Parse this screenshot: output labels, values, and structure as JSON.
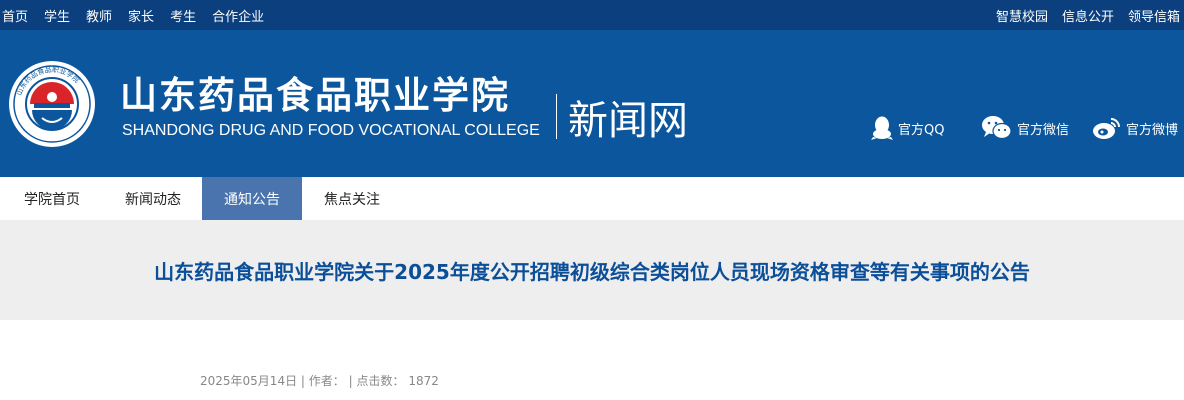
{
  "topbar": {
    "left_links": [
      "首页",
      "学生",
      "教师",
      "家长",
      "考生",
      "合作企业"
    ],
    "right_links": [
      "智慧校园",
      "信息公开",
      "领导信箱"
    ]
  },
  "header": {
    "logo_text": "山东药品食品职业学院",
    "name_cn": "山东药品食品职业学院",
    "name_en": "SHANDONG DRUG AND FOOD VOCATIONAL COLLEGE",
    "section": "新闻网",
    "social": {
      "qq": "官方QQ",
      "wechat": "官方微信",
      "weibo": "官方微博"
    }
  },
  "nav": {
    "items": [
      "学院首页",
      "新闻动态",
      "通知公告",
      "焦点关注"
    ],
    "active_index": 2
  },
  "article": {
    "title": "山东药品食品职业学院关于2025年度公开招聘初级综合类岗位人员现场资格审查等有关事项的公告",
    "date": "2025年05月14日",
    "author_label": "作者：",
    "author": "",
    "views_label": "点击数：",
    "views": "1872"
  },
  "colors": {
    "topbar": "#0b3f7e",
    "header": "#0c569d",
    "nav_active": "#4a74ae",
    "title": "#0b4f99",
    "band": "#eeeeee"
  }
}
